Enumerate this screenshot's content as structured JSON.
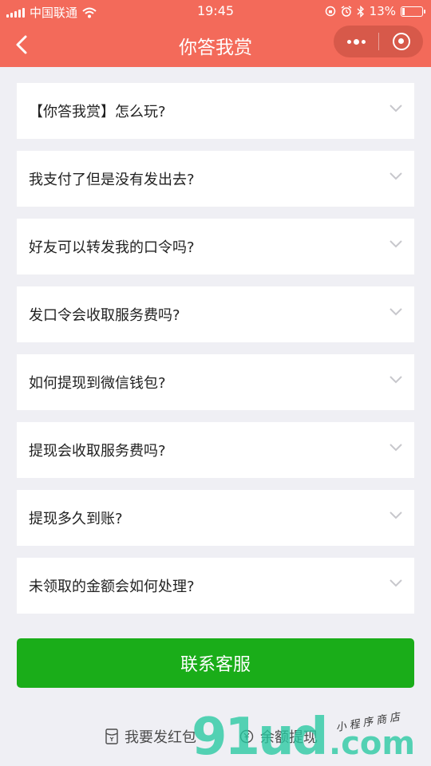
{
  "status_bar": {
    "carrier": "中国联通",
    "time": "19:45",
    "battery_percent": "13%",
    "battery_level": 0.13,
    "icons": [
      "signal-icon",
      "wifi-icon",
      "orientation-lock-icon",
      "alarm-icon",
      "bluetooth-icon",
      "battery-icon"
    ]
  },
  "nav": {
    "title": "你答我赏",
    "back_icon": "back-arrow-icon",
    "more_icon": "more-dots-icon",
    "close_icon": "close-target-icon"
  },
  "faq": {
    "items": [
      {
        "question": "【你答我赏】怎么玩?"
      },
      {
        "question": "我支付了但是没有发出去?"
      },
      {
        "question": "好友可以转发我的口令吗?"
      },
      {
        "question": "发口令会收取服务费吗?"
      },
      {
        "question": "如何提现到微信钱包?"
      },
      {
        "question": "提现会收取服务费吗?"
      },
      {
        "question": "提现多久到账?"
      },
      {
        "question": "未领取的金额会如何处理?"
      }
    ],
    "chevron_icon": "chevron-down-icon"
  },
  "contact_button": {
    "label": "联系客服"
  },
  "bottom_links": {
    "red_packet": {
      "label": "我要发红包",
      "icon": "red-packet-icon"
    },
    "withdraw": {
      "label": "余额提现",
      "icon": "coin-icon"
    }
  },
  "watermark": {
    "brand": "91ud",
    "domain": ".com",
    "tagline": "小程序商店"
  },
  "colors": {
    "header": "#f36a5a",
    "background": "#efeff4",
    "button": "#1aad19",
    "watermark": "#26c8a0"
  }
}
